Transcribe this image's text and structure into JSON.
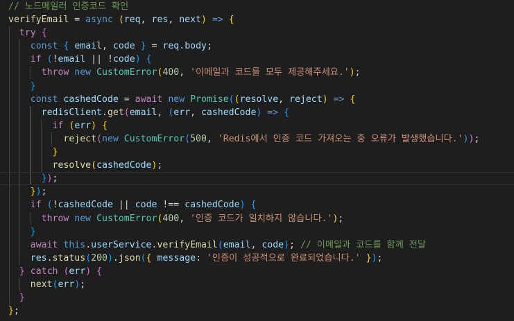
{
  "editor": {
    "theme_colors": {
      "background": "#1e1e1e",
      "comment": "#6a9955",
      "function": "#dcdcaa",
      "variable": "#9cdcfe",
      "keyword": "#569cd6",
      "control": "#c586c0",
      "type": "#4ec9b0",
      "string": "#ce9178",
      "number": "#b5cea8",
      "bracket_1": "#ffd700",
      "bracket_2": "#da70d6",
      "bracket_3": "#179fff"
    },
    "lines": [
      {
        "indent": 0,
        "tokens": [
          [
            "c",
            "// 노드메일러 인증코드 확인"
          ]
        ]
      },
      {
        "indent": 0,
        "tokens": [
          [
            "f",
            "verifyEmail"
          ],
          [
            "p",
            " = "
          ],
          [
            "k",
            "async"
          ],
          [
            "p",
            " "
          ],
          [
            "b1",
            "("
          ],
          [
            "v",
            "req"
          ],
          [
            "p",
            ", "
          ],
          [
            "v",
            "res"
          ],
          [
            "p",
            ", "
          ],
          [
            "v",
            "next"
          ],
          [
            "b1",
            ")"
          ],
          [
            "p",
            " "
          ],
          [
            "k",
            "=>"
          ],
          [
            "p",
            " "
          ],
          [
            "b1",
            "{"
          ]
        ]
      },
      {
        "indent": 1,
        "tokens": [
          [
            "cf",
            "try"
          ],
          [
            "p",
            " "
          ],
          [
            "b2",
            "{"
          ]
        ]
      },
      {
        "indent": 2,
        "tokens": [
          [
            "k",
            "const"
          ],
          [
            "p",
            " "
          ],
          [
            "b3",
            "{"
          ],
          [
            "p",
            " "
          ],
          [
            "v",
            "email"
          ],
          [
            "p",
            ", "
          ],
          [
            "v",
            "code"
          ],
          [
            "p",
            " "
          ],
          [
            "b3",
            "}"
          ],
          [
            "p",
            " = "
          ],
          [
            "v",
            "req"
          ],
          [
            "p",
            "."
          ],
          [
            "v",
            "body"
          ],
          [
            "p",
            ";"
          ]
        ]
      },
      {
        "indent": 2,
        "tokens": [
          [
            "cf",
            "if"
          ],
          [
            "p",
            " "
          ],
          [
            "b3",
            "("
          ],
          [
            "p",
            "!"
          ],
          [
            "v",
            "email"
          ],
          [
            "p",
            " || !"
          ],
          [
            "v",
            "code"
          ],
          [
            "b3",
            ")"
          ],
          [
            "p",
            " "
          ],
          [
            "b3",
            "{"
          ]
        ]
      },
      {
        "indent": 3,
        "tokens": [
          [
            "cf",
            "throw"
          ],
          [
            "p",
            " "
          ],
          [
            "k",
            "new"
          ],
          [
            "p",
            " "
          ],
          [
            "t",
            "CustomError"
          ],
          [
            "b1",
            "("
          ],
          [
            "n",
            "400"
          ],
          [
            "p",
            ", "
          ],
          [
            "s",
            "'이메일과 코드를 모두 제공해주세요.'"
          ],
          [
            "b1",
            ")"
          ],
          [
            "p",
            ";"
          ]
        ]
      },
      {
        "indent": 2,
        "tokens": [
          [
            "b3",
            "}"
          ]
        ]
      },
      {
        "indent": 2,
        "tokens": [
          [
            "k",
            "const"
          ],
          [
            "p",
            " "
          ],
          [
            "v",
            "cashedCode"
          ],
          [
            "p",
            " = "
          ],
          [
            "cf",
            "await"
          ],
          [
            "p",
            " "
          ],
          [
            "k",
            "new"
          ],
          [
            "p",
            " "
          ],
          [
            "t",
            "Promise"
          ],
          [
            "b3",
            "("
          ],
          [
            "b1",
            "("
          ],
          [
            "v",
            "resolve"
          ],
          [
            "p",
            ", "
          ],
          [
            "v",
            "reject"
          ],
          [
            "b1",
            ")"
          ],
          [
            "p",
            " "
          ],
          [
            "k",
            "=>"
          ],
          [
            "p",
            " "
          ],
          [
            "b1",
            "{"
          ]
        ]
      },
      {
        "indent": 3,
        "tokens": [
          [
            "v",
            "redisClient"
          ],
          [
            "p",
            "."
          ],
          [
            "f",
            "get"
          ],
          [
            "b2",
            "("
          ],
          [
            "v",
            "email"
          ],
          [
            "p",
            ", "
          ],
          [
            "b3",
            "("
          ],
          [
            "v",
            "err"
          ],
          [
            "p",
            ", "
          ],
          [
            "v",
            "cashedCode"
          ],
          [
            "b3",
            ")"
          ],
          [
            "p",
            " "
          ],
          [
            "k",
            "=>"
          ],
          [
            "p",
            " "
          ],
          [
            "b3",
            "{"
          ]
        ]
      },
      {
        "indent": 4,
        "tokens": [
          [
            "cf",
            "if"
          ],
          [
            "p",
            " "
          ],
          [
            "b1",
            "("
          ],
          [
            "v",
            "err"
          ],
          [
            "b1",
            ")"
          ],
          [
            "p",
            " "
          ],
          [
            "b1",
            "{"
          ]
        ]
      },
      {
        "indent": 5,
        "tokens": [
          [
            "f",
            "reject"
          ],
          [
            "b2",
            "("
          ],
          [
            "k",
            "new"
          ],
          [
            "p",
            " "
          ],
          [
            "t",
            "CustomError"
          ],
          [
            "b3",
            "("
          ],
          [
            "n",
            "500"
          ],
          [
            "p",
            ", "
          ],
          [
            "s",
            "'Redis에서 인증 코드 가져오는 중 오류가 발생했습니다.'"
          ],
          [
            "b3",
            ")"
          ],
          [
            "b2",
            ")"
          ],
          [
            "p",
            ";"
          ]
        ]
      },
      {
        "indent": 4,
        "tokens": [
          [
            "b1",
            "}"
          ]
        ]
      },
      {
        "indent": 4,
        "tokens": [
          [
            "f",
            "resolve"
          ],
          [
            "b1",
            "("
          ],
          [
            "v",
            "cashedCode"
          ],
          [
            "b1",
            ")"
          ],
          [
            "p",
            ";"
          ]
        ]
      },
      {
        "indent": 3,
        "tokens": [
          [
            "b3",
            "}"
          ],
          [
            "b2",
            ")"
          ],
          [
            "p",
            ";"
          ]
        ]
      },
      {
        "indent": 2,
        "tokens": [
          [
            "b1",
            "}"
          ],
          [
            "b3",
            ")"
          ],
          [
            "p",
            ";"
          ]
        ]
      },
      {
        "indent": 2,
        "tokens": [
          [
            "cf",
            "if"
          ],
          [
            "p",
            " "
          ],
          [
            "b3",
            "("
          ],
          [
            "p",
            "!"
          ],
          [
            "v",
            "cashedCode"
          ],
          [
            "p",
            " || "
          ],
          [
            "v",
            "code"
          ],
          [
            "p",
            " !== "
          ],
          [
            "v",
            "cashedCode"
          ],
          [
            "b3",
            ")"
          ],
          [
            "p",
            " "
          ],
          [
            "b3",
            "{"
          ]
        ]
      },
      {
        "indent": 3,
        "tokens": [
          [
            "cf",
            "throw"
          ],
          [
            "p",
            " "
          ],
          [
            "k",
            "new"
          ],
          [
            "p",
            " "
          ],
          [
            "t",
            "CustomError"
          ],
          [
            "b1",
            "("
          ],
          [
            "n",
            "400"
          ],
          [
            "p",
            ", "
          ],
          [
            "s",
            "'인증 코드가 일치하지 않습니다.'"
          ],
          [
            "b1",
            ")"
          ],
          [
            "p",
            ";"
          ]
        ]
      },
      {
        "indent": 2,
        "tokens": [
          [
            "b3",
            "}"
          ]
        ]
      },
      {
        "indent": 2,
        "tokens": [
          [
            "cf",
            "await"
          ],
          [
            "p",
            " "
          ],
          [
            "k",
            "this"
          ],
          [
            "p",
            "."
          ],
          [
            "v",
            "userService"
          ],
          [
            "p",
            "."
          ],
          [
            "f",
            "verifyEmail"
          ],
          [
            "b3",
            "("
          ],
          [
            "v",
            "email"
          ],
          [
            "p",
            ", "
          ],
          [
            "v",
            "code"
          ],
          [
            "b3",
            ")"
          ],
          [
            "p",
            "; "
          ],
          [
            "c",
            "// 이메일과 코드를 함께 전달"
          ]
        ]
      },
      {
        "indent": 2,
        "tokens": [
          [
            "v",
            "res"
          ],
          [
            "p",
            "."
          ],
          [
            "f",
            "status"
          ],
          [
            "b3",
            "("
          ],
          [
            "n",
            "200"
          ],
          [
            "b3",
            ")"
          ],
          [
            "p",
            "."
          ],
          [
            "f",
            "json"
          ],
          [
            "b3",
            "("
          ],
          [
            "b1",
            "{"
          ],
          [
            "p",
            " "
          ],
          [
            "v",
            "message"
          ],
          [
            "p",
            ": "
          ],
          [
            "s",
            "'인증이 성공적으로 완료되었습니다.'"
          ],
          [
            "p",
            " "
          ],
          [
            "b1",
            "}"
          ],
          [
            "b3",
            ")"
          ],
          [
            "p",
            ";"
          ]
        ]
      },
      {
        "indent": 1,
        "tokens": [
          [
            "b2",
            "}"
          ],
          [
            "p",
            " "
          ],
          [
            "cf",
            "catch"
          ],
          [
            "p",
            " "
          ],
          [
            "b2",
            "("
          ],
          [
            "v",
            "err"
          ],
          [
            "b2",
            ")"
          ],
          [
            "p",
            " "
          ],
          [
            "b2",
            "{"
          ]
        ]
      },
      {
        "indent": 2,
        "tokens": [
          [
            "f",
            "next"
          ],
          [
            "b3",
            "("
          ],
          [
            "v",
            "err"
          ],
          [
            "b3",
            ")"
          ],
          [
            "p",
            ";"
          ]
        ]
      },
      {
        "indent": 1,
        "tokens": [
          [
            "b2",
            "}"
          ]
        ]
      },
      {
        "indent": 0,
        "tokens": [
          [
            "b1",
            "}"
          ],
          [
            "p",
            ";"
          ]
        ]
      }
    ]
  }
}
